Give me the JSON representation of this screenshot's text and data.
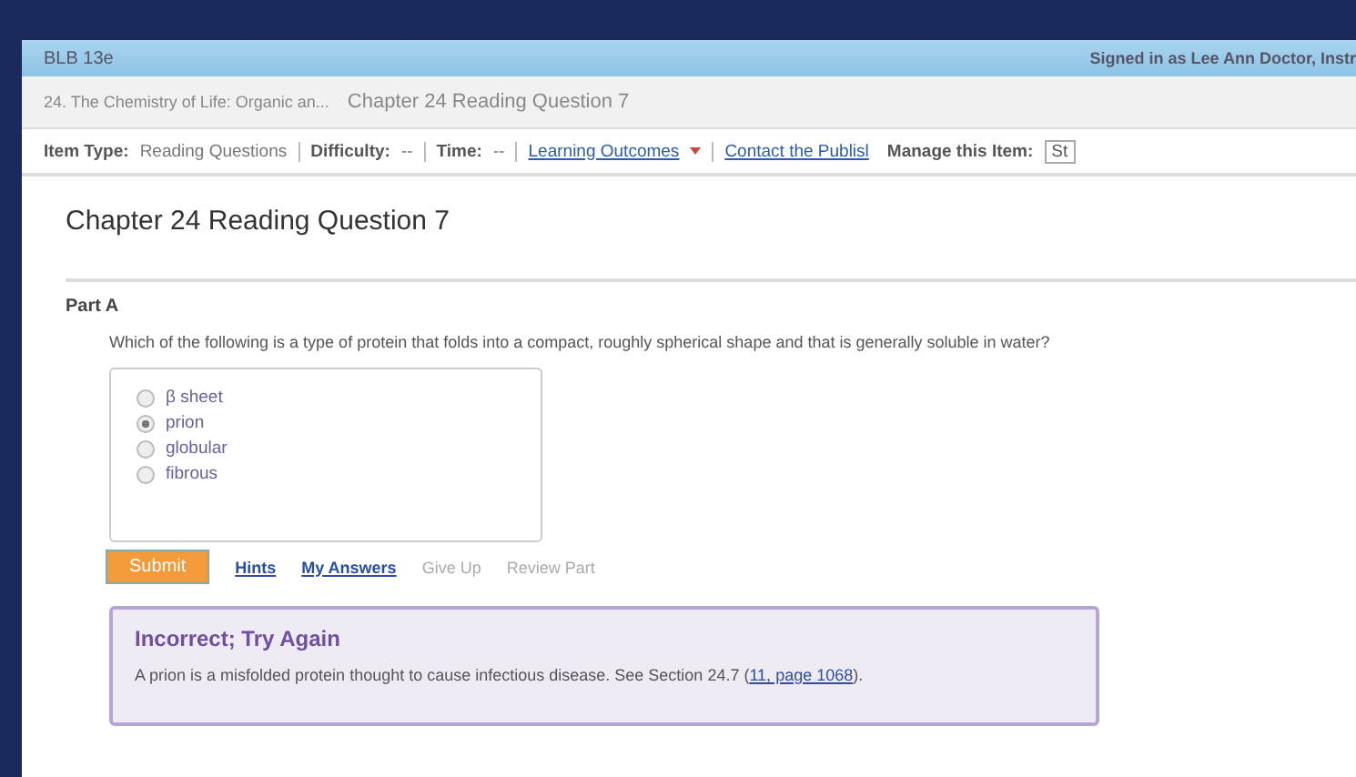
{
  "header": {
    "course": "BLB 13e",
    "user": "Signed in as Lee Ann Doctor, Instr"
  },
  "breadcrumb": [
    {
      "label": "24. The Chemistry of Life: Organic an..."
    },
    {
      "label": "Chapter 24 Reading Question 7"
    }
  ],
  "toolbar": {
    "items": [
      {
        "kind": "pair",
        "label": "Item Type:",
        "value": "Reading Questions"
      },
      {
        "kind": "pair",
        "label": "Difficulty:",
        "value": "--"
      },
      {
        "kind": "pair",
        "label": "Time:",
        "value": "--"
      },
      {
        "kind": "menu",
        "label": "Learning Outcomes"
      },
      {
        "kind": "link",
        "label": "Contact the Publisl"
      }
    ],
    "manage_label": "Manage this Item:",
    "manage_value": "St"
  },
  "title": "Chapter 24 Reading Question 7",
  "part": {
    "label": "Part A",
    "question": "Which of the following is a type of protein that folds into a compact, roughly spherical shape and that is generally soluble in water?",
    "options": [
      {
        "label": "β sheet",
        "selected": false
      },
      {
        "label": "prion",
        "selected": true
      },
      {
        "label": "globular",
        "selected": false
      },
      {
        "label": "fibrous",
        "selected": false
      }
    ],
    "submit": "Submit",
    "actions": [
      {
        "label": "Hints",
        "disabled": false
      },
      {
        "label": "My Answers",
        "disabled": false
      },
      {
        "label": "Give Up",
        "disabled": true
      },
      {
        "label": "Review Part",
        "disabled": true
      }
    ]
  },
  "feedback": {
    "heading": "Incorrect; Try Again",
    "text": "A prion is a misfolded protein thought to cause infectious disease. See Section 24.7 (",
    "link": "11, page 1068",
    "after": ")."
  }
}
